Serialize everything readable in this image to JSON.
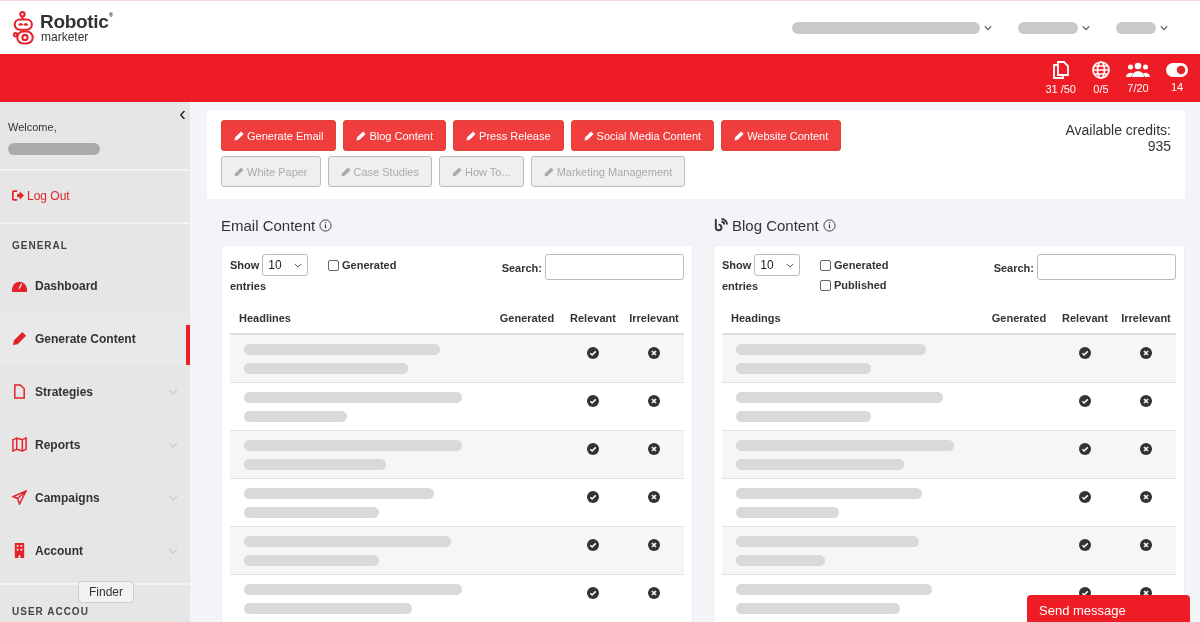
{
  "header": {
    "logo": {
      "name": "Robotic",
      "sub": "marketer",
      "mark": "®"
    },
    "top_menus": [
      {
        "redacted": true
      },
      {
        "redacted": true
      },
      {
        "redacted": true
      }
    ]
  },
  "stats": [
    {
      "kind": "pages",
      "value": "31 /50"
    },
    {
      "kind": "globe",
      "value": "0/5"
    },
    {
      "kind": "users",
      "value": "7/20"
    },
    {
      "kind": "toggle",
      "value": "14"
    }
  ],
  "sidebar": {
    "collapse_icon": "‹",
    "welcome": "Welcome,",
    "logout": "Log Out",
    "section": "GENERAL",
    "items": [
      {
        "kind": "dashboard",
        "label": "Dashboard",
        "selected": false,
        "expandable": false
      },
      {
        "kind": "pencil",
        "label": "Generate Content",
        "selected": true,
        "expandable": false
      },
      {
        "kind": "file",
        "label": "Strategies",
        "selected": false,
        "expandable": true
      },
      {
        "kind": "map",
        "label": "Reports",
        "selected": false,
        "expandable": true
      },
      {
        "kind": "plane",
        "label": "Campaigns",
        "selected": false,
        "expandable": true
      },
      {
        "kind": "building",
        "label": "Account",
        "selected": false,
        "expandable": true
      }
    ],
    "section_2": "USER ACCOU",
    "tooltip": "Finder"
  },
  "content_buttons": [
    {
      "label": "Generate Email",
      "disabled": false
    },
    {
      "label": "Blog Content",
      "disabled": false
    },
    {
      "label": "Press Release",
      "disabled": false
    },
    {
      "label": "Social Media Content",
      "disabled": false
    },
    {
      "label": "Website Content",
      "disabled": false
    },
    {
      "label": "White Paper",
      "disabled": true
    },
    {
      "label": "Case Studies",
      "disabled": true
    },
    {
      "label": "How To...",
      "disabled": true
    },
    {
      "label": "Marketing Management",
      "disabled": true
    }
  ],
  "credits": {
    "label": "Available credits:",
    "value": "935"
  },
  "panels": [
    {
      "kind": "email",
      "title": "Email Content",
      "show": "Show",
      "page_size": "10",
      "entries": "entries",
      "filters": [
        {
          "label": "Generated",
          "checked": false
        }
      ],
      "search_label": "Search:",
      "columns": [
        "Headlines",
        "Generated",
        "Relevant",
        "Irrelevant"
      ],
      "rows": [
        {
          "redacted": true
        },
        {
          "redacted": true
        },
        {
          "redacted": true
        },
        {
          "redacted": true
        },
        {
          "redacted": true
        },
        {
          "redacted": true
        }
      ]
    },
    {
      "kind": "blog",
      "title": "Blog Content",
      "show": "Show",
      "page_size": "10",
      "entries": "entries",
      "filters": [
        {
          "label": "Generated",
          "checked": false
        },
        {
          "label": "Published",
          "checked": false
        }
      ],
      "search_label": "Search:",
      "columns": [
        "Headings",
        "Generated",
        "Relevant",
        "Irrelevant"
      ],
      "rows": [
        {
          "redacted": true
        },
        {
          "redacted": true
        },
        {
          "redacted": true
        },
        {
          "redacted": true
        },
        {
          "redacted": true
        },
        {
          "redacted": true
        }
      ]
    }
  ],
  "chat": {
    "label": "Send message"
  }
}
